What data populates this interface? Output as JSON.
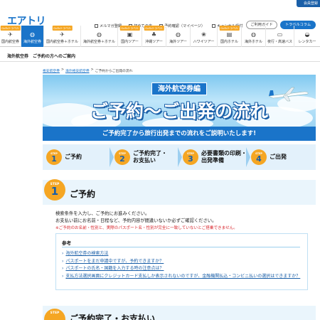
{
  "header": {
    "logo": "エアトリ",
    "member_button": "会員登録",
    "util_links": [
      "メルマガ登録",
      "初めての方",
      "予約確認（マイページ）",
      "キャンセル受付"
    ],
    "guide_button": "ご利用ガイド",
    "travel_button": "トラベルコラム"
  },
  "categories": [
    {
      "label": "国内航空券",
      "tag": "GoToトラベル",
      "icon": "plane-icon",
      "active": false
    },
    {
      "label": "海外航空券",
      "tag": "",
      "icon": "globe-plane-icon",
      "active": true,
      "sub": "海外航空券特集"
    },
    {
      "label": "国内航空券＋ホテル",
      "tag": "GoToトラベル",
      "icon": "plane-hotel-icon",
      "active": false
    },
    {
      "label": "海外航空券＋ホテル",
      "tag": "",
      "icon": "globe-hotel-icon",
      "active": false
    },
    {
      "label": "国内ツアー",
      "tag": "GoToトラベル",
      "icon": "bus-tour-icon",
      "active": false
    },
    {
      "label": "沖縄ツアー",
      "tag": "GoToトラベル",
      "icon": "palm-icon",
      "active": false
    },
    {
      "label": "海外ツアー",
      "tag": "",
      "icon": "globe-tour-icon",
      "active": false
    },
    {
      "label": "ハワイツアー",
      "tag": "",
      "icon": "hawaii-icon",
      "active": false
    },
    {
      "label": "国内ホテル",
      "tag": "GoToトラベル",
      "icon": "hotel-icon",
      "active": false
    },
    {
      "label": "海外ホテル",
      "tag": "",
      "icon": "globe-bed-icon",
      "active": false
    },
    {
      "label": "夜行・高速バス",
      "tag": "",
      "icon": "bus-icon",
      "active": false
    },
    {
      "label": "レンタカー",
      "tag": "",
      "icon": "car-icon",
      "active": false
    }
  ],
  "page_title": "海外航空券　ご予約の方へのご案内",
  "breadcrumb": [
    "格安航空券",
    "海外格安航空券",
    "ご予約からご出発の流れ"
  ],
  "hero": {
    "tag": "海外航空券編",
    "title": "ご予約〜ご出発の流れ",
    "subtitle": "ご予約完了から旅行出発までの流れをご説明いたします!"
  },
  "steps": [
    {
      "label_small": "STEP",
      "number": "1",
      "label": "ご予約"
    },
    {
      "label_small": "STEP",
      "number": "2",
      "label": "ご予約完了・\nお支払い"
    },
    {
      "label_small": "STEP",
      "number": "3",
      "label": "必要書類の印刷・\n出発準備"
    },
    {
      "label_small": "STEP",
      "number": "4",
      "label": "ご出発"
    }
  ],
  "section1": {
    "step_small": "STEP",
    "step_number": "1",
    "title": "ご予約",
    "lines": [
      "検索条件を入力し、ご予約にお進みください。",
      "お支払い前にお名前・日程など、予約内容が間違いないか必ずご確認ください。"
    ],
    "warning": "※ご予約のお名前・性別と、実際のパスポート名・性別が完全に一致していないとご搭乗できません。",
    "ref_title": "参考",
    "ref_links": [
      "海外航空券の検索方法",
      "パスポートをまだ申請中ですが、予約できますか？",
      "パスポートの氏名・国籍を入力する時の注意点は？",
      "支払方法選択画面にクレジットカード支払しか表示されないのですが、金融機関払込・コンビニ払いの選択はできますか？"
    ]
  },
  "section2": {
    "step_small": "STEP",
    "title": "ご予約完了・お支払い"
  }
}
